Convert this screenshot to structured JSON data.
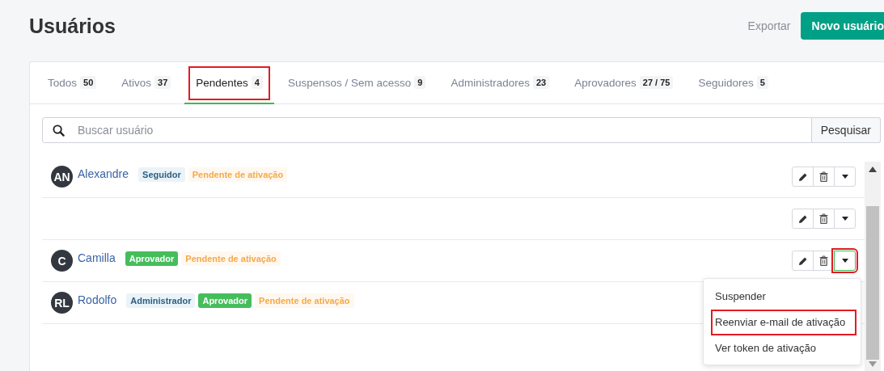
{
  "title": "Usuários",
  "header_actions": {
    "export": "Exportar",
    "new_user": "Novo usuário"
  },
  "tabs": [
    {
      "label": "Todos",
      "count": "50",
      "selected": false,
      "highlighted": false
    },
    {
      "label": "Ativos",
      "count": "37",
      "selected": false,
      "highlighted": false
    },
    {
      "label": "Pendentes",
      "count": "4",
      "selected": true,
      "highlighted": true
    },
    {
      "label": "Suspensos / Sem acesso",
      "count": "9",
      "selected": false,
      "highlighted": false
    },
    {
      "label": "Administradores",
      "count": "23",
      "selected": false,
      "highlighted": false
    },
    {
      "label": "Aprovadores",
      "count": "27 / 75",
      "selected": false,
      "highlighted": false
    },
    {
      "label": "Seguidores",
      "count": "5",
      "selected": false,
      "highlighted": false
    }
  ],
  "search": {
    "placeholder": "Buscar usuário",
    "button": "Pesquisar"
  },
  "users": [
    {
      "initials": "AN",
      "name": "Alexandre",
      "tags": [
        {
          "label": "Seguidor",
          "kind": "role"
        },
        {
          "label": "Pendente de ativação",
          "kind": "pending"
        }
      ],
      "menu_open": false,
      "highlighted": false
    },
    {
      "menu_open": false,
      "highlighted": false
    },
    {
      "initials": "C",
      "name": "Camilla",
      "tags": [
        {
          "label": "Aprovador",
          "kind": "approver"
        },
        {
          "label": "Pendente de ativação",
          "kind": "pending"
        }
      ],
      "menu_open": true,
      "highlighted": true
    },
    {
      "initials": "RL",
      "name": "Rodolfo",
      "tags": [
        {
          "label": "Administrador",
          "kind": "role"
        },
        {
          "label": "Aprovador",
          "kind": "approver"
        },
        {
          "label": "Pendente de ativação",
          "kind": "pending"
        }
      ],
      "menu_open": false
    }
  ],
  "menu": [
    {
      "label": "Suspender",
      "highlighted": false
    },
    {
      "label": "Reenviar e-mail de ativação",
      "highlighted": true
    },
    {
      "label": "Ver token de ativação",
      "highlighted": false
    }
  ]
}
